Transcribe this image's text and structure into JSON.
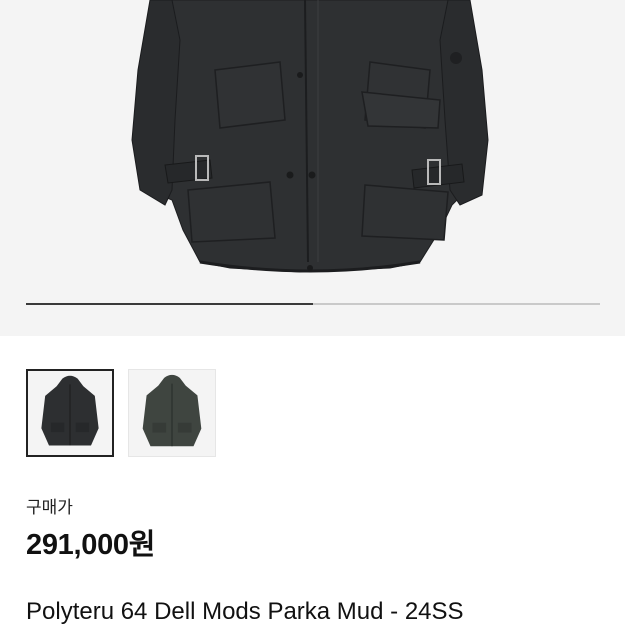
{
  "gallery": {
    "image_position": 0.5,
    "thumbnails": [
      {
        "alt": "black parka thumbnail",
        "selected": true,
        "color": "#2d2f31"
      },
      {
        "alt": "olive parka thumbnail",
        "selected": false,
        "color": "#3f4540"
      }
    ]
  },
  "price": {
    "label": "구매가",
    "value": "291,000원"
  },
  "product": {
    "title": "Polyteru 64 Dell Mods Parka Mud - 24SS"
  },
  "colors": {
    "jacket": "#2e3032",
    "background": "#f4f4f4",
    "progress_active": "#3a3a3a",
    "progress_track": "#c9c9c9"
  }
}
